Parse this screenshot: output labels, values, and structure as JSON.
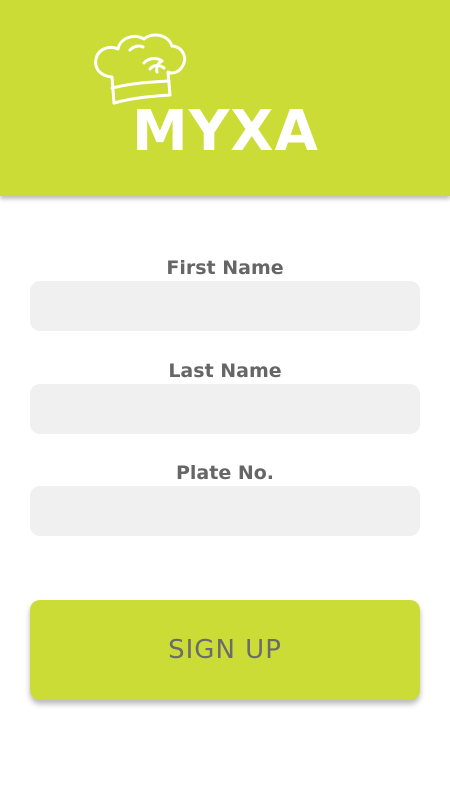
{
  "colors": {
    "brand_green": "#ccdc37",
    "input_background": "#f0f0f0",
    "label_text": "#666666",
    "button_text": "#6b6b6b",
    "background": "#ffffff"
  },
  "header": {
    "logo_text": "MYXA",
    "logo_icon": "chef-hat-icon"
  },
  "form": {
    "fields": [
      {
        "label": "First Name",
        "value": "",
        "placeholder": ""
      },
      {
        "label": "Last Name",
        "value": "",
        "placeholder": ""
      },
      {
        "label": "Plate No.",
        "value": "",
        "placeholder": ""
      }
    ],
    "submit_label": "SIGN UP"
  }
}
